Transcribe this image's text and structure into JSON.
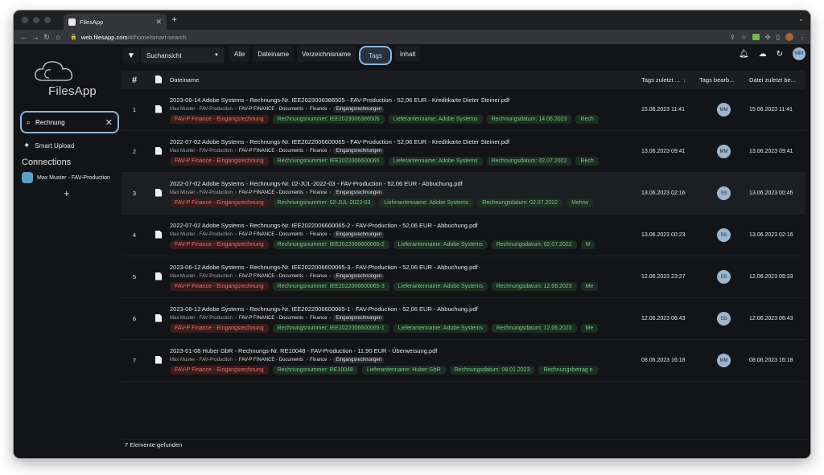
{
  "browser": {
    "tab_title": "FilesApp",
    "url_host": "web.filesapp.com",
    "url_path": "/#/home/smart-search"
  },
  "sidebar": {
    "logo_text": "FilesApp",
    "search_value": "Rechnung",
    "smart_upload": "Smart Upload",
    "connections_title": "Connections",
    "connection_name": "Max Muster - FAV-Production",
    "add_label": "+"
  },
  "toolbar": {
    "view_select": "Suchansicht",
    "tabs": [
      "Alle",
      "Dateiname",
      "Verzeichnisname",
      "Tags",
      "Inhalt"
    ],
    "user_initials": "MM"
  },
  "table": {
    "headers": {
      "num": "#",
      "name": "Dateiname",
      "tags_date": "Tags zuletzt ...",
      "tags_edit": "Tags bearb...",
      "file_date": "Datei zuletzt be..."
    },
    "breadcrumb": {
      "owner": "Max Muster - FAV-Production",
      "root": "FAV-P FINANCE - Documents",
      "folder": "Finance",
      "subfolder": "Eingangsrechnungen"
    },
    "rows": [
      {
        "num": "1",
        "name": "2023-06-14 Adobe Systems - Rechnungs-Nr. IEE2023006386505 - FAV-Production - 52,06 EUR - Kreditkarte Dieter Steiner.pdf",
        "tags": [
          "FAV-P Finance - Eingangsrechnung",
          "Rechnungsnummer: IEE2023006386505",
          "Lieferantenname: Adobe Systems",
          "Rechnungsdatum: 14.06.2023",
          "Rech"
        ],
        "tags_date": "15.06.2023 11:41",
        "editor": "MM",
        "file_date": "15.06.2023 11:41"
      },
      {
        "num": "2",
        "name": "2022-07-02 Adobe Systems - Rechnungs-Nr. IEE2022006600065 - FAV-Production - 52,06 EUR - Kreditkarte Dieter Steiner.pdf",
        "tags": [
          "FAV-P Finance - Eingangsrechnung",
          "Rechnungsnummer: IEE2022006600065",
          "Lieferantenname: Adobe Systems",
          "Rechnungsdatum: 02.07.2022",
          "Rech"
        ],
        "tags_date": "13.06.2023 09:41",
        "editor": "MM",
        "file_date": "13.06.2023 09:41"
      },
      {
        "num": "3",
        "name": "2022-07-02 Adobe Systems - Rechnungs-Nr. 02-JUL-2022-03 - FAV-Production - 52,06 EUR - Abbuchung.pdf",
        "tags": [
          "FAV-P Finance - Eingangsrechnung",
          "Rechnungsnummer: 02-JUL-2022-03",
          "Lieferantenname: Adobe Systems",
          "Rechnungsdatum: 02.07.2022",
          "Mehrw"
        ],
        "tags_date": "13.06.2023 02:16",
        "editor": "SS",
        "file_date": "13.06.2023 00:45"
      },
      {
        "num": "4",
        "name": "2022-07-02 Adobe Systems - Rechnungs-Nr. IEE2022006600065-2 - FAV-Production - 52,06 EUR - Abbuchung.pdf",
        "tags": [
          "FAV-P Finance - Eingangsrechnung",
          "Rechnungsnummer: IEE2022006600065-2",
          "Lieferantenname: Adobe Systems",
          "Rechnungsdatum: 02.07.2022",
          "M"
        ],
        "tags_date": "13.06.2023 00:23",
        "editor": "SS",
        "file_date": "13.06.2023 02:16"
      },
      {
        "num": "5",
        "name": "2023-06-12 Adobe Systems - Rechnungs-Nr. IEE2022006600065-3 - FAV-Production - 52,06 EUR - Abbuchung.pdf",
        "tags": [
          "FAV-P Finance - Eingangsrechnung",
          "Rechnungsnummer: IEE2022006600065-3",
          "Lieferantenname: Adobe Systems",
          "Rechnungsdatum: 12.06.2023",
          "Me"
        ],
        "tags_date": "12.06.2023 23:27",
        "editor": "SS",
        "file_date": "12.06.2023 09:33"
      },
      {
        "num": "6",
        "name": "2023-06-12 Adobe Systems - Rechnungs-Nr. IEE2022006600065-1 - FAV-Production - 52,06 EUR - Abbuchung.pdf",
        "tags": [
          "FAV-P Finance - Eingangsrechnung",
          "Rechnungsnummer: IEE2022006600065-1",
          "Lieferantenname: Adobe Systems",
          "Rechnungsdatum: 12.06.2023",
          "Me"
        ],
        "tags_date": "12.06.2023 06:43",
        "editor": "SS",
        "file_date": "12.06.2023 06:43"
      },
      {
        "num": "7",
        "name": "2023-01-08 Huber GbR - Rechnungs-Nr. RE10048 - FAV-Production - 11,90 EUR - Überweisung.pdf",
        "tags": [
          "FAV-P Finance - Eingangsrechnung",
          "Rechnungsnummer: RE10048",
          "Lieferantenname: Huber GbR",
          "Rechnungsdatum: 08.01.2023",
          "Rechnungsbetrag n"
        ],
        "tags_date": "08.06.2023 16:18",
        "editor": "MM",
        "file_date": "08.06.2023 16:18"
      }
    ]
  },
  "footer": {
    "count": "7 Elemente gefunden"
  }
}
